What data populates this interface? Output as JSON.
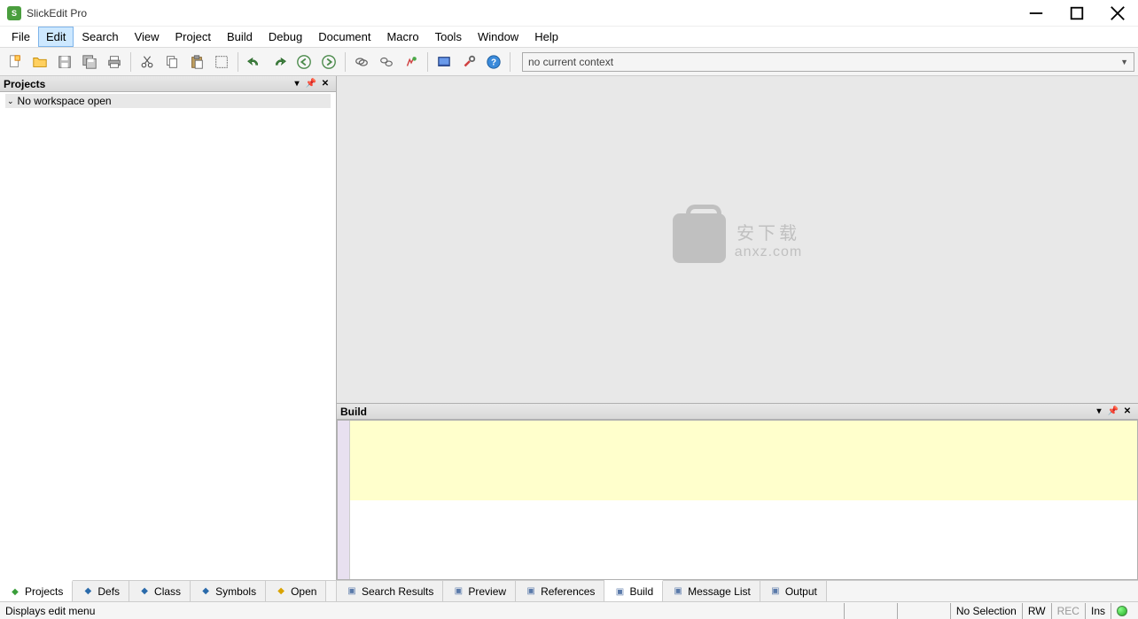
{
  "app": {
    "title": "SlickEdit Pro"
  },
  "menus": [
    "File",
    "Edit",
    "Search",
    "View",
    "Project",
    "Build",
    "Debug",
    "Document",
    "Macro",
    "Tools",
    "Window",
    "Help"
  ],
  "menu_active_index": 1,
  "context_text": "no current context",
  "projects_panel": {
    "title": "Projects",
    "item": "No workspace open"
  },
  "build_panel": {
    "title": "Build"
  },
  "left_tabs": [
    {
      "label": "Projects",
      "icon": "projects-icon",
      "color": "#3a9e3a"
    },
    {
      "label": "Defs",
      "icon": "defs-icon",
      "color": "#2a6aaa"
    },
    {
      "label": "Class",
      "icon": "class-icon",
      "color": "#2a6aaa"
    },
    {
      "label": "Symbols",
      "icon": "symbols-icon",
      "color": "#2a6aaa"
    },
    {
      "label": "Open",
      "icon": "open-icon",
      "color": "#d9a300"
    }
  ],
  "left_tab_active": 0,
  "right_tabs": [
    {
      "label": "Search Results",
      "icon": "search-results-icon"
    },
    {
      "label": "Preview",
      "icon": "preview-icon"
    },
    {
      "label": "References",
      "icon": "references-icon"
    },
    {
      "label": "Build",
      "icon": "build-icon"
    },
    {
      "label": "Message List",
      "icon": "message-list-icon"
    },
    {
      "label": "Output",
      "icon": "output-icon"
    }
  ],
  "right_tab_active": 3,
  "status": {
    "message": "Displays edit menu",
    "selection": "No Selection",
    "rw": "RW",
    "rec": "REC",
    "ins": "Ins"
  },
  "watermark": {
    "cn": "安下载",
    "en": "anxz.com"
  }
}
